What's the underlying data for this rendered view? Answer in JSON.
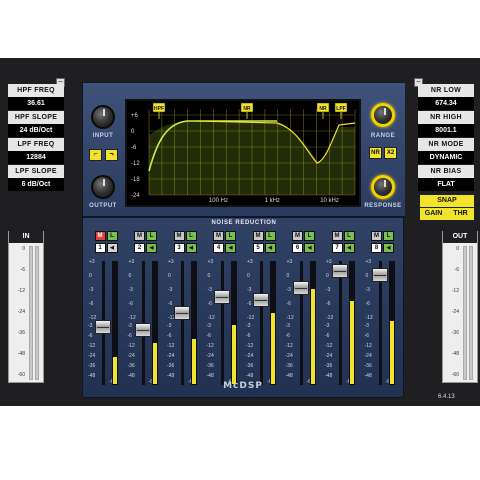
{
  "left_panel": {
    "collapse_label": "–",
    "params": [
      {
        "label": "HPF FREQ",
        "value": "36.61"
      },
      {
        "label": "HPF SLOPE",
        "value": "24 dB/Oct"
      },
      {
        "label": "LPF FREQ",
        "value": "12884"
      },
      {
        "label": "LPF SLOPE",
        "value": "6 dB/Oct"
      }
    ]
  },
  "right_panel": {
    "collapse_label": "–",
    "params": [
      {
        "label": "NR LOW",
        "value": "674.34"
      },
      {
        "label": "NR HIGH",
        "value": "8001.1"
      },
      {
        "label": "NR MODE",
        "value": "DYNAMIC"
      },
      {
        "label": "NR BIAS",
        "value": "FLAT"
      }
    ],
    "snap_label": "SNAP",
    "gain_label": "GAIN",
    "thr_label": "THR"
  },
  "in_meter": {
    "title": "IN",
    "scale": [
      "0",
      "-6",
      "-12",
      "-24",
      "-36",
      "-48",
      "-60"
    ]
  },
  "out_meter": {
    "title": "OUT",
    "scale": [
      "0",
      "-6",
      "-12",
      "-24",
      "-36",
      "-48",
      "-60"
    ]
  },
  "top_controls": {
    "input_label": "INPUT",
    "output_label": "OUTPUT",
    "range_label": "RANGE",
    "response_label": "RESPONSE",
    "nr_button": "NR",
    "x2_button": "X2"
  },
  "eq_display": {
    "y_ticks": [
      "+6",
      "0",
      "-6",
      "-12",
      "-18",
      "-24"
    ],
    "x_ticks": [
      "100 Hz",
      "1 kHz",
      "10 kHz"
    ],
    "markers": [
      "HPF",
      "NR",
      "NR",
      "LPF"
    ]
  },
  "noise_reduction": {
    "title": "NOISE REDUCTION",
    "fader_scale": [
      "+3",
      "0",
      "-3",
      "-6",
      "-12"
    ],
    "meter_scale": [
      "-3",
      "-6",
      "-12",
      "-24",
      "-36",
      "-48"
    ],
    "bottom_label": "-60",
    "channels": [
      {
        "num": "1",
        "mute": "M",
        "link": "L",
        "mute_on": true,
        "level": 0.22,
        "fader": 0.46
      },
      {
        "num": "2",
        "mute": "M",
        "link": "L",
        "mute_on": false,
        "level": 0.34,
        "fader": 0.44
      },
      {
        "num": "3",
        "mute": "M",
        "link": "L",
        "mute_on": false,
        "level": 0.37,
        "fader": 0.59
      },
      {
        "num": "4",
        "mute": "M",
        "link": "L",
        "mute_on": false,
        "level": 0.48,
        "fader": 0.74
      },
      {
        "num": "5",
        "mute": "M",
        "link": "L",
        "mute_on": false,
        "level": 0.58,
        "fader": 0.71
      },
      {
        "num": "6",
        "mute": "M",
        "link": "L",
        "mute_on": false,
        "level": 0.78,
        "fader": 0.82
      },
      {
        "num": "7",
        "mute": "M",
        "link": "L",
        "mute_on": false,
        "level": 0.68,
        "fader": 0.97
      },
      {
        "num": "8",
        "mute": "M",
        "link": "L",
        "mute_on": false,
        "level": 0.52,
        "fader": 0.94
      }
    ]
  },
  "brand": "McDSP",
  "version": "6.4.13",
  "colors": {
    "accent": "#f2e32b",
    "console": "#2b3b5f",
    "mute_on": "#e0413b",
    "link": "#7ac050"
  }
}
